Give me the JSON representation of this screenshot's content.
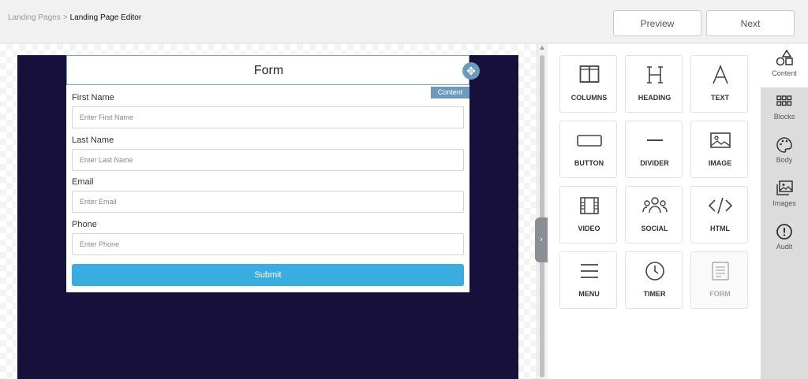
{
  "breadcrumb": {
    "parent": "Landing Pages",
    "separator": ">",
    "current": "Landing Page Editor"
  },
  "header": {
    "preview_label": "Preview",
    "next_label": "Next"
  },
  "editor": {
    "form_title": "Form",
    "content_badge": "Content",
    "move_icon": "move-arrows-icon",
    "fields": [
      {
        "label": "First Name",
        "placeholder": "Enter First Name"
      },
      {
        "label": "Last Name",
        "placeholder": "Enter Last Name"
      },
      {
        "label": "Email",
        "placeholder": "Enter Email"
      },
      {
        "label": "Phone",
        "placeholder": "Enter Phone"
      }
    ],
    "submit_label": "Submit",
    "page_background": "#16103a",
    "submit_color": "#3aade0"
  },
  "tools": [
    {
      "label": "COLUMNS",
      "icon": "columns-icon"
    },
    {
      "label": "HEADING",
      "icon": "heading-icon"
    },
    {
      "label": "TEXT",
      "icon": "text-icon"
    },
    {
      "label": "BUTTON",
      "icon": "button-icon"
    },
    {
      "label": "DIVIDER",
      "icon": "divider-icon"
    },
    {
      "label": "IMAGE",
      "icon": "image-icon"
    },
    {
      "label": "VIDEO",
      "icon": "video-icon"
    },
    {
      "label": "SOCIAL",
      "icon": "social-icon"
    },
    {
      "label": "HTML",
      "icon": "code-icon"
    },
    {
      "label": "MENU",
      "icon": "menu-icon"
    },
    {
      "label": "TIMER",
      "icon": "timer-icon"
    },
    {
      "label": "FORM",
      "icon": "form-icon",
      "disabled": true
    }
  ],
  "sidetabs": [
    {
      "label": "Content",
      "icon": "shapes-icon",
      "active": true
    },
    {
      "label": "Blocks",
      "icon": "grid-icon"
    },
    {
      "label": "Body",
      "icon": "palette-icon"
    },
    {
      "label": "Images",
      "icon": "images-icon"
    },
    {
      "label": "Audit",
      "icon": "alert-icon"
    }
  ]
}
